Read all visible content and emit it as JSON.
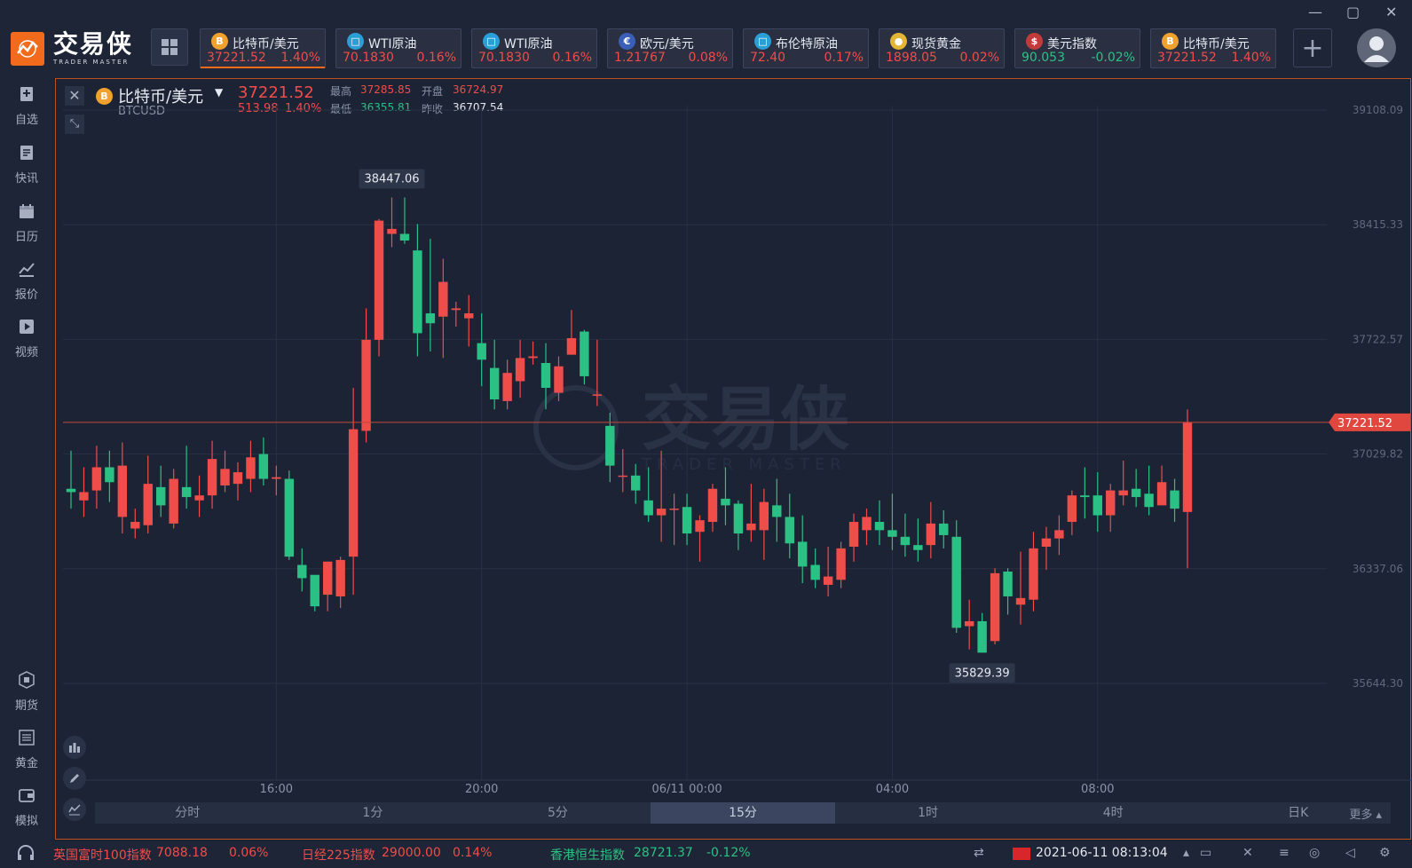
{
  "brand": {
    "name_cn": "交易侠",
    "name_en": "TRADER MASTER"
  },
  "tabs": [
    {
      "name": "比特币/美元",
      "price": "37221.52",
      "pct": "1.40%",
      "dir": "up",
      "icon": "bitcoin-icon",
      "icon_color": "#f1a12d",
      "icon_glyph": "B"
    },
    {
      "name": "WTI原油",
      "price": "70.1830",
      "pct": "0.16%",
      "dir": "up",
      "icon": "oil-icon",
      "icon_color": "#2a9fd6",
      "icon_glyph": "□"
    },
    {
      "name": "WTI原油",
      "price": "70.1830",
      "pct": "0.16%",
      "dir": "up",
      "icon": "oil-icon",
      "icon_color": "#2a9fd6",
      "icon_glyph": "□"
    },
    {
      "name": "欧元/美元",
      "price": "1.21767",
      "pct": "0.08%",
      "dir": "up",
      "icon": "eu-us-flag-icon",
      "icon_color": "#3a5fb8",
      "icon_glyph": "€"
    },
    {
      "name": "布伦特原油",
      "price": "72.40",
      "pct": "0.17%",
      "dir": "up",
      "icon": "oil-icon",
      "icon_color": "#2a9fd6",
      "icon_glyph": "□"
    },
    {
      "name": "现货黄金",
      "price": "1898.05",
      "pct": "0.02%",
      "dir": "up",
      "icon": "gold-icon",
      "icon_color": "#e2b534",
      "icon_glyph": "●"
    },
    {
      "name": "美元指数",
      "price": "90.053",
      "pct": "-0.02%",
      "dir": "down",
      "icon": "us-flag-icon",
      "icon_color": "#c23b3b",
      "icon_glyph": "$"
    },
    {
      "name": "比特币/美元",
      "price": "37221.52",
      "pct": "1.40%",
      "dir": "up",
      "icon": "bitcoin-icon",
      "icon_color": "#f1a12d",
      "icon_glyph": "B"
    }
  ],
  "leftnav": [
    {
      "label": "自选",
      "icon": "favorites-icon"
    },
    {
      "label": "快讯",
      "icon": "news-icon"
    },
    {
      "label": "日历",
      "icon": "calendar-icon"
    },
    {
      "label": "报价",
      "icon": "quotes-icon"
    },
    {
      "label": "视频",
      "icon": "video-icon"
    },
    {
      "label": "期货",
      "icon": "futures-icon"
    },
    {
      "label": "黄金",
      "icon": "gold-nav-icon"
    },
    {
      "label": "模拟",
      "icon": "simulation-icon"
    }
  ],
  "quote": {
    "name": "比特币/美元",
    "code": "BTCUSD",
    "price": "37221.52",
    "change": "513.98",
    "pct": "1.40%",
    "high_label": "最高",
    "high": "37285.85",
    "open_label": "开盘",
    "open": "36724.97",
    "low_label": "最低",
    "low": "36355.81",
    "prev_label": "昨收",
    "prev": "36707.54"
  },
  "timeframes": [
    "分时",
    "1分",
    "5分",
    "15分",
    "1时",
    "4时",
    "日K"
  ],
  "active_timeframe": "15分",
  "more_label": "更多",
  "chart_data": {
    "type": "candlestick",
    "y_ticks": [
      "39108.09",
      "38415.33",
      "37722.57",
      "37029.82",
      "36337.06",
      "35644.30"
    ],
    "x_ticks": [
      "16:00",
      "20:00",
      "06/11 00:00",
      "04:00",
      "08:00"
    ],
    "current_price": "37221.52",
    "max_label": "38447.06",
    "min_label": "35829.39",
    "up_color": "#ef4d4a",
    "down_color": "#2cc184",
    "candles": [
      [
        36820,
        36800,
        37050,
        36700
      ],
      [
        36750,
        36800,
        36950,
        36650
      ],
      [
        36810,
        36950,
        37080,
        36700
      ],
      [
        36950,
        36860,
        37050,
        36740
      ],
      [
        36650,
        36960,
        37100,
        36550
      ],
      [
        36580,
        36620,
        36700,
        36520
      ],
      [
        36600,
        36850,
        37020,
        36550
      ],
      [
        36830,
        36720,
        36960,
        36650
      ],
      [
        36610,
        36880,
        36940,
        36580
      ],
      [
        36830,
        36770,
        37080,
        36700
      ],
      [
        36750,
        36780,
        36900,
        36650
      ],
      [
        36780,
        37000,
        37110,
        36700
      ],
      [
        36840,
        36940,
        37050,
        36800
      ],
      [
        36850,
        36920,
        36980,
        36750
      ],
      [
        36880,
        37010,
        37110,
        36800
      ],
      [
        37030,
        36880,
        37130,
        36840
      ],
      [
        36880,
        36890,
        36960,
        36780
      ],
      [
        36880,
        36410,
        36930,
        36390
      ],
      [
        36360,
        36280,
        36460,
        36200
      ],
      [
        36300,
        36110,
        36250,
        36080
      ],
      [
        36180,
        36380,
        36380,
        36080
      ],
      [
        36170,
        36390,
        36410,
        36100
      ],
      [
        36410,
        37180,
        37430,
        36180
      ],
      [
        37170,
        37720,
        37910,
        37100
      ],
      [
        37720,
        38440,
        38450,
        37620
      ],
      [
        38360,
        38390,
        38580,
        38280
      ],
      [
        38360,
        38320,
        38580,
        38300
      ],
      [
        38260,
        37760,
        38420,
        37620
      ],
      [
        37880,
        37820,
        38330,
        37650
      ],
      [
        37860,
        38070,
        38210,
        37610
      ],
      [
        37900,
        37910,
        37950,
        37800
      ],
      [
        37850,
        37880,
        37990,
        37680
      ],
      [
        37700,
        37600,
        37880,
        37440
      ],
      [
        37550,
        37360,
        37720,
        37300
      ],
      [
        37350,
        37520,
        37600,
        37300
      ],
      [
        37470,
        37610,
        37720,
        37370
      ],
      [
        37610,
        37620,
        37710,
        37570
      ],
      [
        37580,
        37430,
        37700,
        37300
      ],
      [
        37400,
        37560,
        37620,
        37350
      ],
      [
        37630,
        37730,
        37900,
        37630
      ],
      [
        37770,
        37500,
        37780,
        37450
      ],
      [
        37390,
        37390,
        37720,
        37320
      ],
      [
        37200,
        36960,
        37280,
        36860
      ],
      [
        36900,
        36900,
        37060,
        36800
      ],
      [
        36900,
        36810,
        36970,
        36730
      ],
      [
        36750,
        36660,
        36950,
        36620
      ],
      [
        36660,
        36700,
        37050,
        36500
      ],
      [
        36700,
        36700,
        36790,
        36480
      ],
      [
        36710,
        36550,
        36790,
        36480
      ],
      [
        36560,
        36630,
        36660,
        36380
      ],
      [
        36620,
        36820,
        36850,
        36560
      ],
      [
        36760,
        36720,
        36950,
        36600
      ],
      [
        36730,
        36550,
        36750,
        36450
      ],
      [
        36570,
        36610,
        36850,
        36500
      ],
      [
        36570,
        36740,
        36820,
        36390
      ],
      [
        36720,
        36650,
        36880,
        36500
      ],
      [
        36650,
        36490,
        36790,
        36400
      ],
      [
        36500,
        36350,
        36660,
        36250
      ],
      [
        36360,
        36270,
        36460,
        36220
      ],
      [
        36240,
        36290,
        36470,
        36170
      ],
      [
        36270,
        36460,
        36500,
        36220
      ],
      [
        36470,
        36620,
        36670,
        36380
      ],
      [
        36570,
        36650,
        36700,
        36480
      ],
      [
        36620,
        36570,
        36750,
        36480
      ],
      [
        36570,
        36530,
        36790,
        36450
      ],
      [
        36530,
        36480,
        36670,
        36410
      ],
      [
        36480,
        36450,
        36640,
        36380
      ],
      [
        36480,
        36610,
        36740,
        36400
      ],
      [
        36610,
        36540,
        36690,
        36460
      ],
      [
        36530,
        35980,
        36630,
        35950
      ],
      [
        35990,
        36020,
        36150,
        35850
      ],
      [
        36020,
        35830,
        36070,
        35830
      ],
      [
        35900,
        36310,
        36340,
        35880
      ],
      [
        36320,
        36170,
        36340,
        36060
      ],
      [
        36120,
        36160,
        36440,
        36000
      ],
      [
        36150,
        36460,
        36560,
        36080
      ],
      [
        36470,
        36520,
        36590,
        36330
      ],
      [
        36520,
        36570,
        36660,
        36420
      ],
      [
        36620,
        36780,
        36810,
        36540
      ],
      [
        36780,
        36770,
        36950,
        36640
      ],
      [
        36780,
        36660,
        36920,
        36560
      ],
      [
        36660,
        36810,
        36850,
        36560
      ],
      [
        36780,
        36810,
        36990,
        36720
      ],
      [
        36820,
        36770,
        36940,
        36710
      ],
      [
        36790,
        36710,
        36960,
        36660
      ],
      [
        36720,
        36860,
        36960,
        36720
      ],
      [
        36810,
        36700,
        36880,
        36620
      ],
      [
        36680,
        37220,
        37300,
        36340
      ]
    ]
  },
  "status": {
    "items": [
      {
        "name": "英国富时100指数",
        "value": "7088.18",
        "pct": "0.06%",
        "dir": "up"
      },
      {
        "name": "日经225指数",
        "value": "29000.00",
        "pct": "0.14%",
        "dir": "up"
      },
      {
        "name": "香港恒生指数",
        "value": "28721.37",
        "pct": "-0.12%",
        "dir": "down"
      }
    ],
    "datetime": "2021-06-11 08:13:04"
  }
}
